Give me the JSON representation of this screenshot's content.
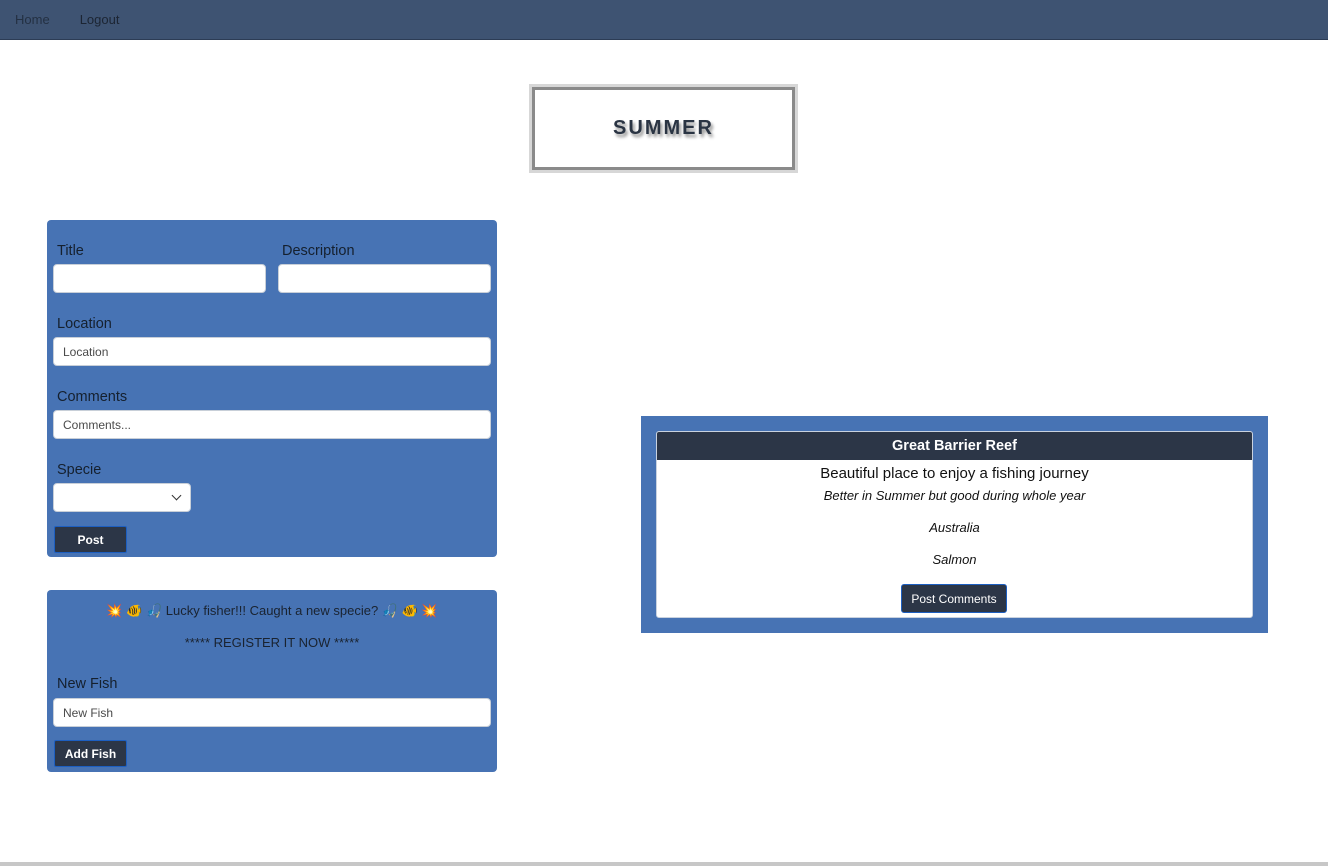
{
  "nav": {
    "home_label": "Home",
    "logout_label": "Logout"
  },
  "season": {
    "title": "SUMMER"
  },
  "post_form": {
    "title_label": "Title",
    "title_value": "",
    "description_label": "Description",
    "description_value": "",
    "location_label": "Location",
    "location_placeholder": "Location",
    "comments_label": "Comments",
    "comments_placeholder": "Comments...",
    "specie_label": "Specie",
    "specie_selected": "",
    "post_button": "Post"
  },
  "fish_form": {
    "banner_line": "💥 🐠 🎣 Lucky fisher!!! Caught a new specie? 🎣 🐠 💥",
    "register_line": "***** REGISTER IT NOW *****",
    "new_fish_label": "New Fish",
    "new_fish_placeholder": "New Fish",
    "add_button": "Add Fish"
  },
  "location_card": {
    "title": "Great Barrier Reef",
    "description": "Beautiful place to enjoy a fishing journey",
    "comment": "Better in Summer but good during whole year",
    "location": "Australia",
    "specie": "Salmon",
    "button": "Post Comments"
  },
  "colors": {
    "navbar": "#3e5372",
    "panel": "#4773b4",
    "dark_button": "#2c3647"
  }
}
